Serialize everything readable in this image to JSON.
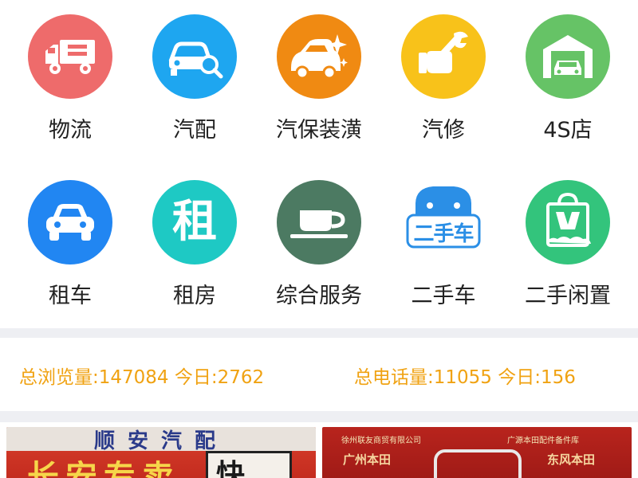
{
  "categories": [
    {
      "label": "物流",
      "icon": "truck-icon",
      "color": "#ee6b6b"
    },
    {
      "label": "汽配",
      "icon": "car-search-icon",
      "color": "#1ea6f0"
    },
    {
      "label": "汽保装潢",
      "icon": "car-sparkle-icon",
      "color": "#f08a12"
    },
    {
      "label": "汽修",
      "icon": "wrench-hand-icon",
      "color": "#f8c21a"
    },
    {
      "label": "4S店",
      "icon": "garage-icon",
      "color": "#66c366"
    },
    {
      "label": "租车",
      "icon": "car-icon",
      "color": "#2186f2"
    },
    {
      "label": "租房",
      "icon": "rent-character-icon",
      "glyph": "租",
      "color": "#1ec9c4"
    },
    {
      "label": "综合服务",
      "icon": "coffee-cup-icon",
      "color": "#4c7a62"
    },
    {
      "label": "二手车",
      "icon": "used-car-badge-icon",
      "glyph": "二手车",
      "color": "#2b8fe6"
    },
    {
      "label": "二手闲置",
      "icon": "shopping-bag-icon",
      "color": "#33c47c"
    }
  ],
  "stats": {
    "total_views_label": "总浏览量:",
    "total_views": "147084",
    "views_today_label": "今日:",
    "views_today": "2762",
    "total_calls_label": "总电话量:",
    "total_calls": "11055",
    "calls_today_label": "今日:",
    "calls_today": "156",
    "color": "#f0a212"
  },
  "banners": {
    "left": {
      "top_text": "顺安汽配",
      "main_text": "长安专卖",
      "box_text": "快"
    },
    "right": {
      "line_left": "徐州联友商贸有限公司",
      "line_right": "广源本田配件备件库",
      "brand_left": "广州本田",
      "brand_right": "东风本田"
    }
  }
}
